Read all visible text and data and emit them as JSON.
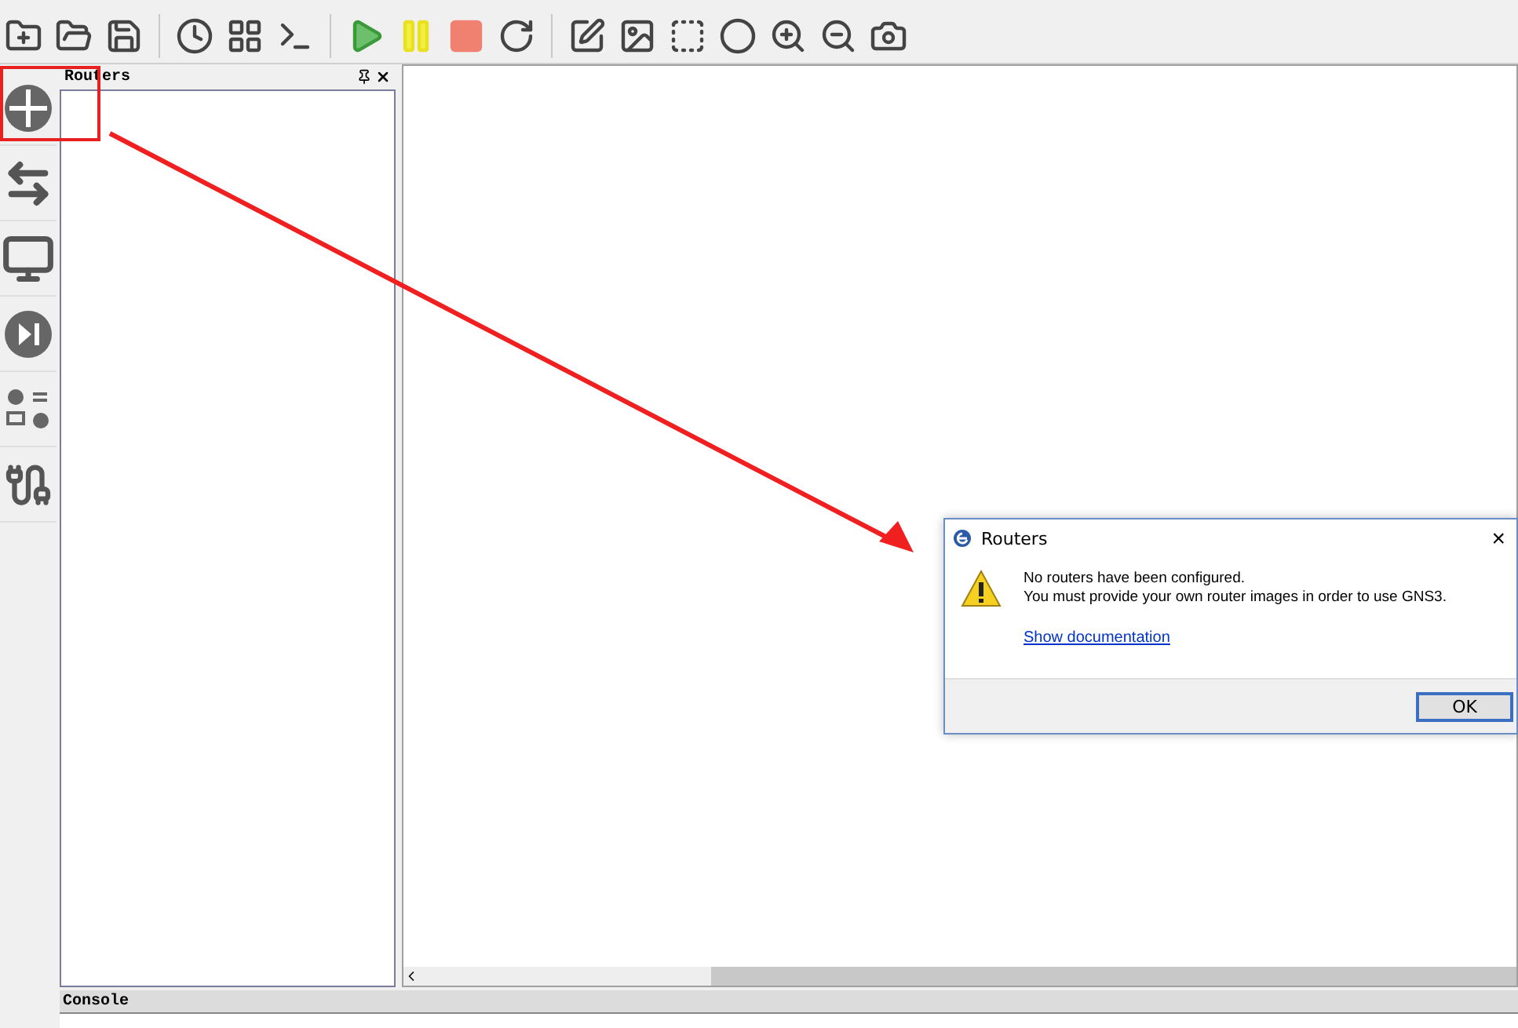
{
  "dock": {
    "title": "Routers"
  },
  "console": {
    "title": "Console"
  },
  "dialog": {
    "title": "Routers",
    "close": "×",
    "lines": [
      "No routers have been configured.",
      "You must provide your own router images in order to use GNS3."
    ],
    "link": "Show documentation",
    "button": "OK"
  }
}
